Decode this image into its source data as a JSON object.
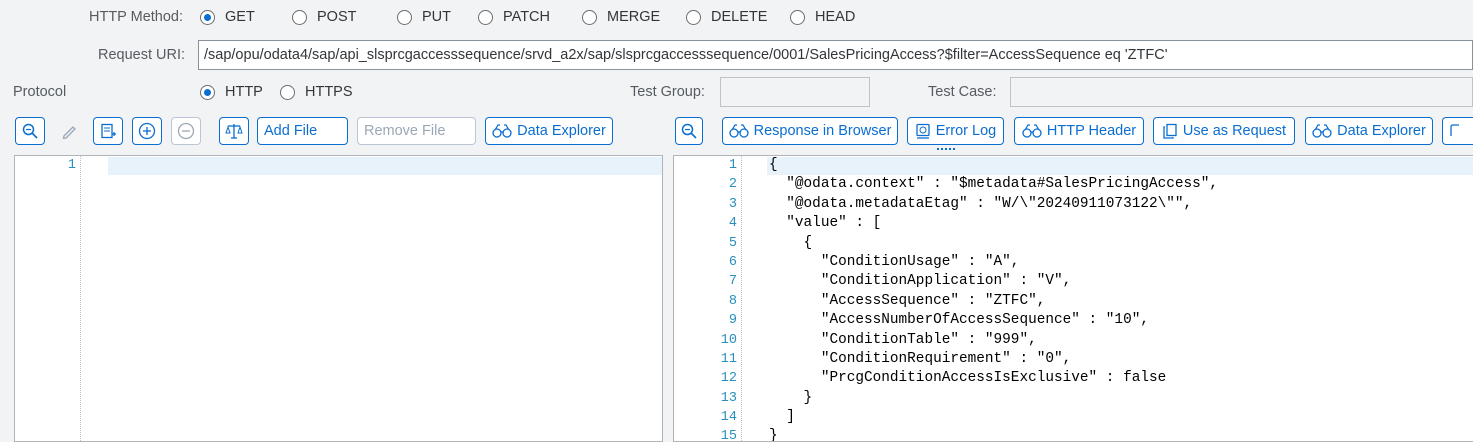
{
  "method": {
    "label": "HTTP Method:",
    "options": [
      "GET",
      "POST",
      "PUT",
      "PATCH",
      "MERGE",
      "DELETE",
      "HEAD"
    ],
    "selected": "GET"
  },
  "request": {
    "label": "Request URI:",
    "value": "/sap/opu/odata4/sap/api_slsprcgaccesssequence/srvd_a2x/sap/slsprcgaccesssequence/0001/SalesPricingAccess?$filter=AccessSequence eq 'ZTFC'"
  },
  "protocol": {
    "label": "Protocol",
    "options": [
      "HTTP",
      "HTTPS"
    ],
    "selected": "HTTP"
  },
  "test_group": {
    "label": "Test Group:",
    "value": ""
  },
  "test_case": {
    "label": "Test Case:",
    "value": ""
  },
  "left_toolbar": {
    "add_file": "Add File",
    "remove_file": "Remove File",
    "data_explorer": "Data Explorer"
  },
  "right_toolbar": {
    "response_in_browser": "Response in Browser",
    "error_log": "Error Log",
    "http_header": "HTTP Header",
    "use_as_request": "Use as Request",
    "data_explorer": "Data Explorer"
  },
  "request_editor": {
    "lines": [
      ""
    ]
  },
  "response_editor": {
    "lines": [
      "{",
      "  \"@odata.context\" : \"$metadata#SalesPricingAccess\",",
      "  \"@odata.metadataEtag\" : \"W/\\\"20240911073122\\\"\",",
      "  \"value\" : [",
      "    {",
      "      \"ConditionUsage\" : \"A\",",
      "      \"ConditionApplication\" : \"V\",",
      "      \"AccessSequence\" : \"ZTFC\",",
      "      \"AccessNumberOfAccessSequence\" : \"10\",",
      "      \"ConditionTable\" : \"999\",",
      "      \"ConditionRequirement\" : \"0\",",
      "      \"PrcgConditionAccessIsExclusive\" : false",
      "    }",
      "  ]",
      "}"
    ]
  },
  "colors": {
    "accent": "#0a6ed1",
    "line_number": "#2a8fbd",
    "current_line": "#e8f2fb"
  }
}
